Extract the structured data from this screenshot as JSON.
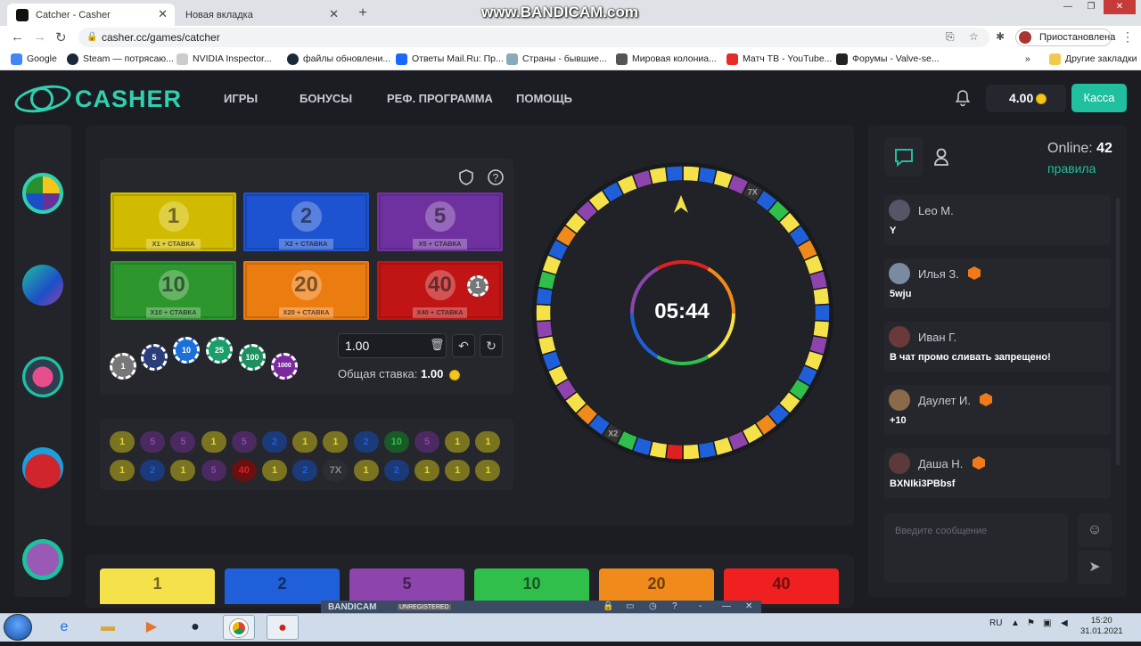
{
  "browser": {
    "tabs": [
      {
        "title": "Catcher - Casher"
      },
      {
        "title": "Новая вкладка"
      }
    ],
    "url": "casher.cc/games/catcher",
    "profile_label": "Приостановлена",
    "bookmarks": [
      "Google",
      "Steam — потрясаю...",
      "NVIDIA Inspector...",
      "файлы обновлени...",
      "Ответы Mail.Ru: Пр...",
      "Страны - бывшие...",
      "Мировая колониа...",
      "Матч ТВ - YouTube...",
      "Форумы - Valve-se..."
    ],
    "other_bookmarks": "Другие закладки",
    "overflow": "»"
  },
  "watermark": "www.BANDICAM.com",
  "header": {
    "logo_text": "CASHER",
    "nav": [
      "ИГРЫ",
      "БОНУСЫ",
      "РЕФ. ПРОГРАММА",
      "ПОМОЩЬ"
    ],
    "balance": "4.00",
    "cash_button": "Касса"
  },
  "game": {
    "bills": [
      {
        "number": "1",
        "caption": "X1 + СТАВКА",
        "color": "#c7b200"
      },
      {
        "number": "2",
        "caption": "X2 + СТАВКА",
        "color": "#1c4fc7"
      },
      {
        "number": "5",
        "caption": "X5 + СТАВКА",
        "color": "#6a2f98"
      },
      {
        "number": "10",
        "caption": "X10 + СТАВКА",
        "color": "#2b8f2b"
      },
      {
        "number": "20",
        "caption": "X20 + СТАВКА",
        "color": "#e0760f"
      },
      {
        "number": "40",
        "caption": "X40 + СТАВКА",
        "color": "#b81414"
      }
    ],
    "placed_chip": "1",
    "chips": [
      "1",
      "5",
      "10",
      "25",
      "100",
      "1000"
    ],
    "bet_value": "1.00",
    "total_label": "Общая ставка:",
    "total_value": "1.00",
    "history_row1": [
      "1",
      "5",
      "5",
      "1",
      "5",
      "2",
      "1",
      "1",
      "2",
      "10",
      "5",
      "1",
      "1"
    ],
    "history_row2": [
      "1",
      "2",
      "1",
      "5",
      "40",
      "1",
      "2",
      "7X",
      "1",
      "2",
      "1",
      "1",
      "1"
    ],
    "timer": "05:44",
    "wheel_labels": [
      "7X",
      "X2"
    ],
    "bet_buttons": [
      "1",
      "2",
      "5",
      "10",
      "20",
      "40"
    ]
  },
  "chat": {
    "online_label": "Online:",
    "online_count": "42",
    "rules_label": "правила",
    "messages": [
      {
        "name": "Leo M.",
        "text": "Y"
      },
      {
        "name": "Илья З.",
        "text": "5wju"
      },
      {
        "name": "Иван Г.",
        "text": "В чат промо сливать запрещено!"
      },
      {
        "name": "Даулет И.",
        "text": "+10"
      },
      {
        "name": "Даша Н.",
        "text": "BXNIki3PBbsf"
      }
    ],
    "input_placeholder": "Введите сообщение"
  },
  "bandicam": {
    "label": "BANDICAM",
    "unregistered": "UNREGISTERED"
  },
  "taskbar": {
    "lang": "RU",
    "time": "15:20",
    "date": "31.01.2021"
  }
}
